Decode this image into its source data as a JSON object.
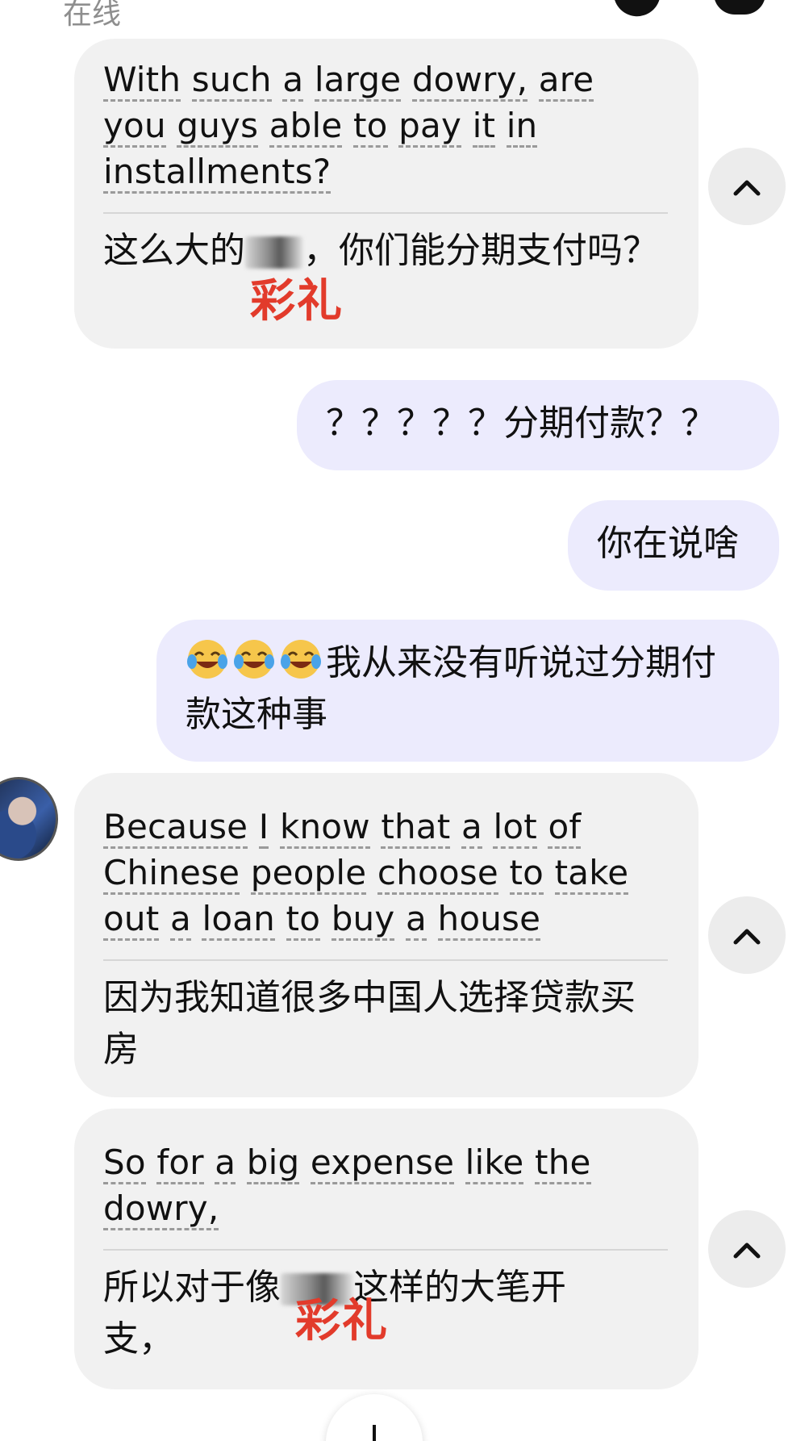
{
  "header": {
    "status": "在线",
    "call_icon": "phone-icon",
    "settings_icon": "gear-icon"
  },
  "messages": [
    {
      "direction": "incoming",
      "original_words": [
        "With",
        "such",
        "a",
        "large",
        "dowry,",
        "are",
        "you",
        "guys",
        "able",
        "to",
        "pay",
        "it",
        "in",
        "installments?"
      ],
      "translation_pre": "这么大的",
      "translation_post": "，你们能分期支付吗？",
      "annotation": "彩礼"
    },
    {
      "direction": "outgoing",
      "text": "？？？？？分期付款？？"
    },
    {
      "direction": "outgoing",
      "text": "你在说啥"
    },
    {
      "direction": "outgoing",
      "emoji": "😂😂😂",
      "text": "我从来没有听说过分期付款这种事"
    },
    {
      "direction": "incoming",
      "original_words": [
        "Because",
        "I",
        "know",
        "that",
        "a",
        "lot",
        "of",
        "Chinese",
        "people",
        "choose",
        "to",
        "take",
        "out",
        "a",
        "loan",
        "to",
        "buy",
        "a",
        "house"
      ],
      "translation": "因为我知道很多中国人选择贷款买房"
    },
    {
      "direction": "incoming",
      "original_words": [
        "So",
        "for",
        "a",
        "big",
        "expense",
        "like",
        "the",
        "dowry,"
      ],
      "translation_pre": "所以对于像",
      "translation_post": "这样的大笔开支，",
      "annotation": "彩礼"
    }
  ],
  "colors": {
    "incoming_bubble": "#f1f1f1",
    "outgoing_bubble": "#ecebfd",
    "annotation": "#e23b2b",
    "status_text": "#8e8e8e"
  },
  "icons": {
    "collapse": "chevron-up-icon",
    "scroll_down": "arrow-down-icon",
    "emoji": "tears-of-joy-emoji"
  }
}
